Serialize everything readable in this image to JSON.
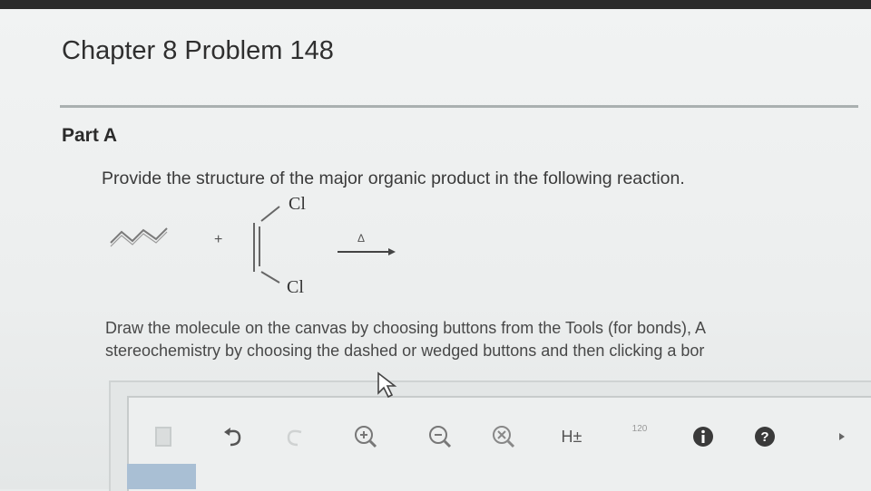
{
  "header": {
    "title": "Chapter 8 Problem 148"
  },
  "part": {
    "label": "Part A"
  },
  "question": {
    "text": "Provide the structure of the major organic product in the following reaction."
  },
  "reaction": {
    "plus": "+",
    "condition": "Δ",
    "substituent_top": "Cl",
    "substituent_bottom": "Cl"
  },
  "instructions": {
    "line1": "Draw the molecule on the canvas by choosing buttons from the Tools (for bonds), A",
    "line2": "stereochemistry by choosing the dashed or wedged buttons and then clicking a bor"
  },
  "toolbar": {
    "hydrogen_label": "H±",
    "template_label": "120"
  },
  "colors": {
    "accent_dark": "#2b2b2b",
    "tab_blue": "#a9bfd4"
  },
  "icons": [
    "undo-icon",
    "redo-icon",
    "zoom-in-icon",
    "zoom-out-icon",
    "zoom-reset-icon",
    "info-icon",
    "help-icon",
    "chevron-right-icon",
    "cursor-icon"
  ]
}
